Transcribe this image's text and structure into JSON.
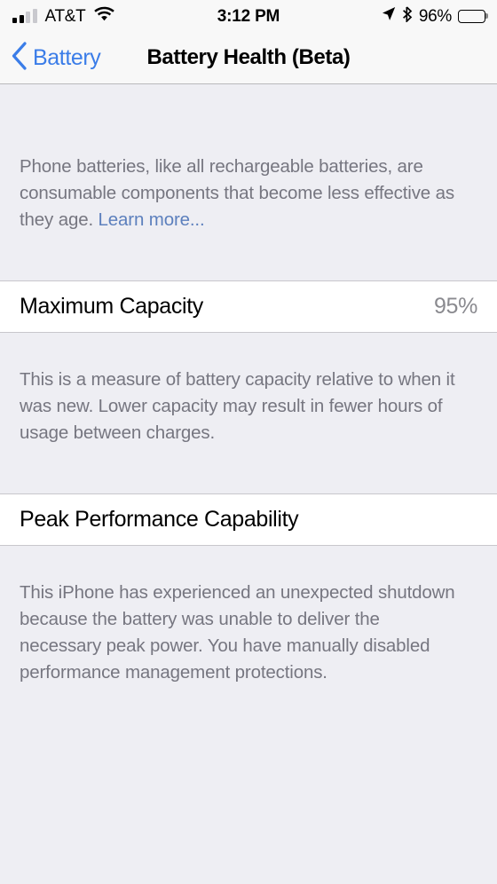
{
  "status_bar": {
    "carrier": "AT&T",
    "signal_bars_total": 4,
    "signal_bars_active": 2,
    "wifi_icon": "wifi-icon",
    "time": "3:12 PM",
    "location_icon": "location-arrow-icon",
    "bluetooth_icon": "bluetooth-icon",
    "battery_percent": "96%",
    "battery_level": 96
  },
  "nav_bar": {
    "back_icon": "chevron-left-icon",
    "back_label": "Battery",
    "title": "Battery Health (Beta)"
  },
  "content": {
    "intro_note_before_link": "Phone batteries, like all rechargeable batteries, are consumable components that become less effective as they age. ",
    "intro_note_link": "Learn more...",
    "maximum_capacity": {
      "label": "Maximum Capacity",
      "value": "95%",
      "note": "This is a measure of battery capacity relative to when it was new. Lower capacity may result in fewer hours of usage between charges."
    },
    "peak_performance": {
      "label": "Peak Performance Capability",
      "note": "This iPhone has experienced an unexpected shutdown because the battery was unable to deliver the necessary peak power. You have manually disabled performance management protections."
    }
  },
  "colors": {
    "accent_blue": "#3b7de8",
    "link_blue": "#5d80bd",
    "group_background": "#eeeef3",
    "cell_background": "#ffffff",
    "secondary_text": "#767680",
    "value_text": "#8a8a8f"
  }
}
